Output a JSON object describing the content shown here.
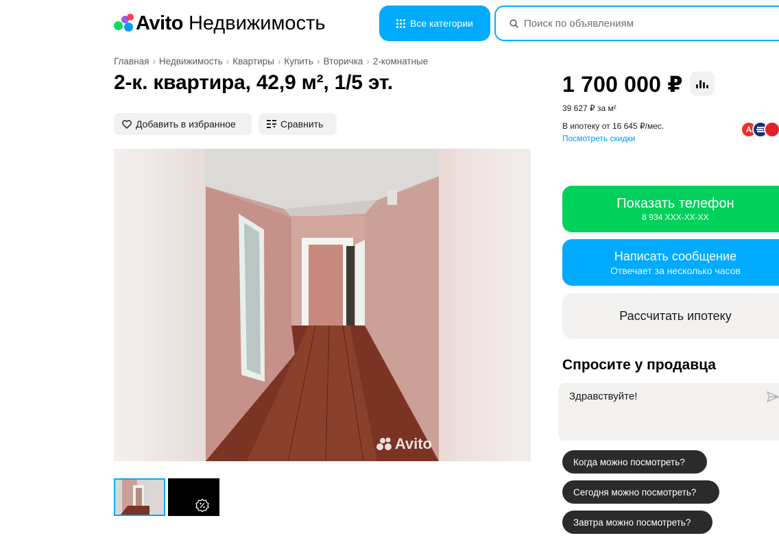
{
  "header": {
    "brand": "Avito",
    "section": "Недвижимость",
    "categories_label": "Все категории",
    "search_placeholder": "Поиск по объявлениям"
  },
  "breadcrumbs": [
    "Главная",
    "Недвижимость",
    "Квартиры",
    "Купить",
    "Вторичка",
    "2-комнатные"
  ],
  "listing": {
    "title": "2-к. квартира, 42,9 м², 1/5 эт.",
    "favorite_label": "Добавить в избранное",
    "compare_label": "Сравнить",
    "watermark": "Avito"
  },
  "pricing": {
    "price": "1 700 000 ₽",
    "price_per_m2": "39 627 ₽ за м²",
    "mortgage": "В ипотеку от 16 645 ₽/мес.",
    "discounts_link": "Посмотреть скидки",
    "bank_letters": [
      "А",
      "",
      ""
    ]
  },
  "actions": {
    "show_phone": "Показать телефон",
    "phone_mask": "8 934 XXX-XX-XX",
    "write_message": "Написать сообщение",
    "response_time": "Отвечает за несколько часов",
    "calc_mortgage": "Рассчитать ипотеку"
  },
  "ask_seller": {
    "title": "Спросите у продавца",
    "message": "Здравствуйте!",
    "quick_questions": [
      "Когда можно посмотреть?",
      "Сегодня можно посмотреть?",
      "Завтра можно посмотреть?"
    ]
  },
  "colors": {
    "accent_blue": "#00aaff",
    "call_green": "#02d15c",
    "chip_dark": "#2b2b2b",
    "pill_gray": "#f2f1f0"
  },
  "icons": [
    "avito-logo-icon",
    "grid-dots-icon",
    "search-icon",
    "heart-icon",
    "compare-icon",
    "stats-bar-icon",
    "send-icon",
    "discount-badge-icon"
  ]
}
